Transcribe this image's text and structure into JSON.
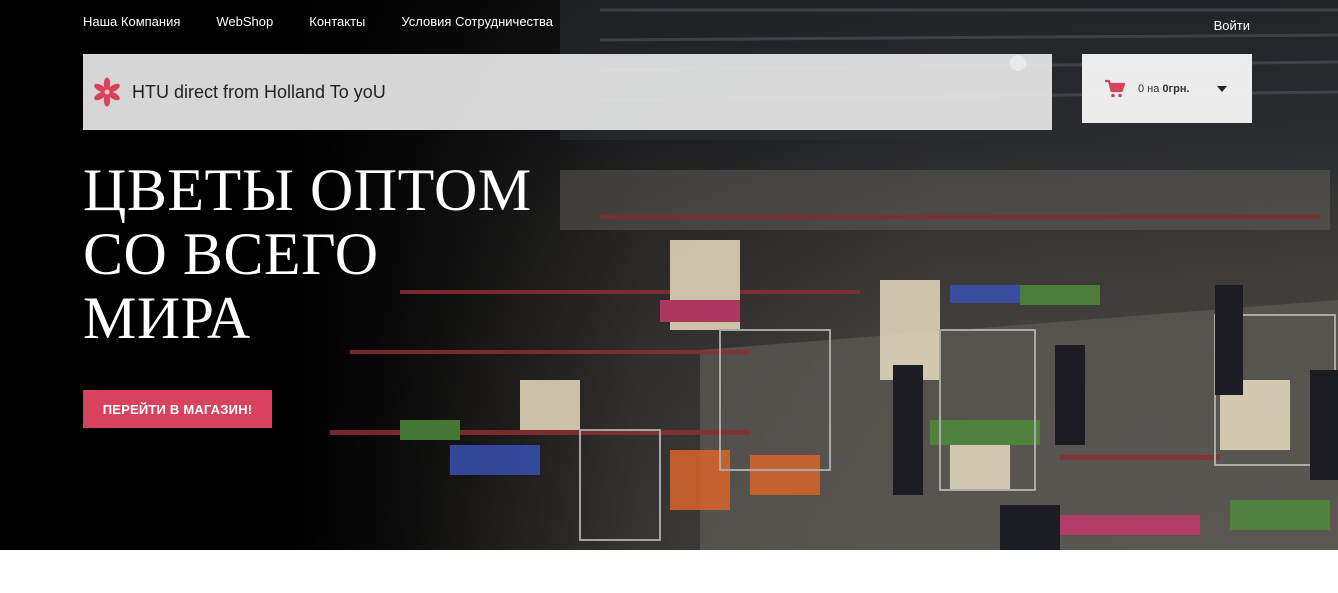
{
  "nav": {
    "items": [
      {
        "label": "Наша Компания"
      },
      {
        "label": "WebShop"
      },
      {
        "label": "Контакты"
      },
      {
        "label": "Условия Сотрудничества"
      }
    ],
    "login_label": "Войти"
  },
  "brand": {
    "name": "HTU direct from Holland To yoU",
    "icon": "flower-logo-icon",
    "accent_color": "#d8425c"
  },
  "cart": {
    "count_prefix": "0 на ",
    "amount": "0грн.",
    "icon": "cart-icon"
  },
  "hero": {
    "headline_lines": [
      "ЦВЕТЫ ОПТОМ",
      "СО ВСЕГО",
      "МИРА"
    ],
    "button_label": "ПЕРЕЙТИ В МАГАЗИН!"
  }
}
